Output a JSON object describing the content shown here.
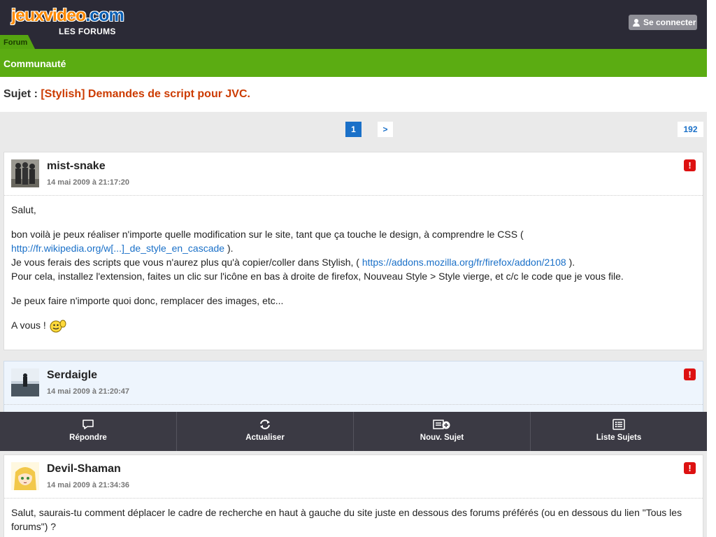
{
  "header": {
    "logo_jv": "jeuxvideo",
    "logo_com": ".com",
    "logo_sub": "LES FORUMS",
    "connect_label": "Se connecter",
    "forum_tab": "Forum"
  },
  "category": "Communauté",
  "subject": {
    "prefix": "Sujet :",
    "title": "[Stylish] Demandes de script pour JVC."
  },
  "pagination": {
    "current": "1",
    "next": ">",
    "last": "192"
  },
  "posts": [
    {
      "author": "mist-snake",
      "date": "14 mai 2009 à 21:17:20",
      "report": "!",
      "p1": "Salut,",
      "p2a": "bon voilà je peux réaliser n'importe quelle modification sur le site, tant que ça touche le design, à comprendre le CSS (",
      "link1": "http://fr.wikipedia.org/w[...]_de_style_en_cascade",
      "p2b": ").",
      "p2c": "Je vous ferais des scripts que vous n'aurez plus qu'à copier/coller dans Stylish, (",
      "link2": "https://addons.mozilla.org/fr/firefox/addon/2108",
      "p2d": ").",
      "p2e": "Pour cela, installez l'extension, faites un clic sur l'icône en bas à droite de firefox, Nouveau Style > Style vierge, et c/c le code que je vous file.",
      "p3": "Je peux faire n'importe quoi donc, remplacer des images, etc...",
      "p4": "A vous !"
    },
    {
      "author": "Serdaigle",
      "date": "14 mai 2009 à 21:20:47",
      "report": "!"
    },
    {
      "author": "Devil-Shaman",
      "date": "14 mai 2009 à 21:34:36",
      "report": "!",
      "p1": "Salut, saurais-tu comment déplacer le cadre de recherche en haut à gauche du site juste en dessous des forums préférés (ou en dessous du lien \"Tous les forums\") ?"
    }
  ],
  "actions": [
    {
      "label": "Répondre",
      "icon": "reply-icon"
    },
    {
      "label": "Actualiser",
      "icon": "refresh-icon"
    },
    {
      "label": "Nouv. Sujet",
      "icon": "new-topic-icon"
    },
    {
      "label": "Liste Sujets",
      "icon": "list-icon"
    }
  ],
  "colors": {
    "header_bg": "#2b2a36",
    "green": "#5bac12",
    "title_red": "#cc3b00",
    "link_blue": "#1a70c8",
    "report_red": "#dd1111"
  }
}
